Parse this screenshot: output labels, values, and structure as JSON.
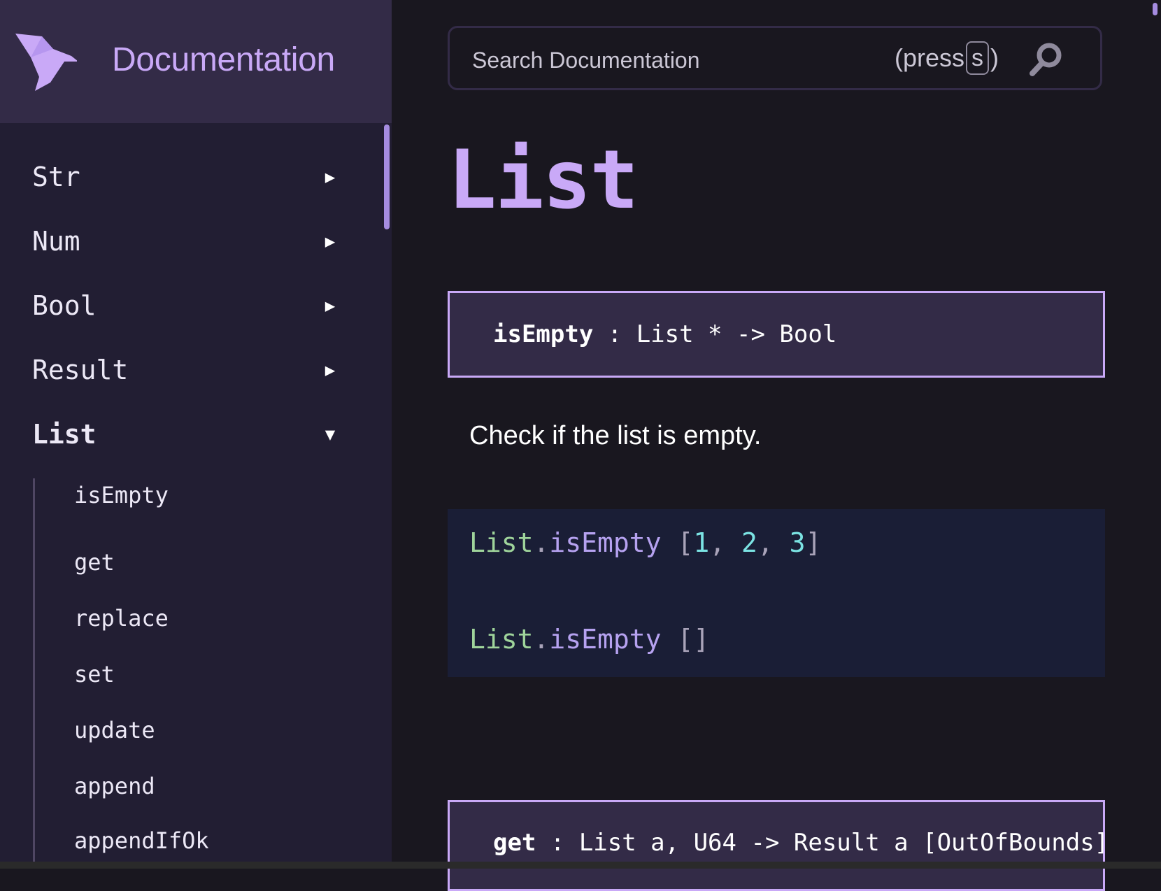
{
  "header": {
    "title": "Documentation"
  },
  "search": {
    "placeholder": "Search Documentation",
    "hint_prefix": "(press ",
    "hint_key": "s",
    "hint_suffix": ")"
  },
  "sidebar": {
    "modules": [
      {
        "label": "Str",
        "arrow": "▶"
      },
      {
        "label": "Num",
        "arrow": "▶"
      },
      {
        "label": "Bool",
        "arrow": "▶"
      },
      {
        "label": "Result",
        "arrow": "▶"
      },
      {
        "label": "List",
        "arrow": "▼",
        "expanded": true
      }
    ],
    "list_entries": [
      "isEmpty",
      "get",
      "replace",
      "set",
      "update",
      "append",
      "appendIfOk"
    ]
  },
  "main": {
    "page_title": "List",
    "entries": [
      {
        "name": "isEmpty",
        "signature": " : List * -> Bool",
        "description": "Check if the list is empty.",
        "examples": [
          {
            "module": "List",
            "dot": ".",
            "fn": "isEmpty",
            "space": " ",
            "open": "[",
            "n1": "1",
            "sep1": ", ",
            "n2": "2",
            "sep2": ", ",
            "n3": "3",
            "close": "]"
          },
          {
            "module": "List",
            "dot": ".",
            "fn": "isEmpty",
            "space": " ",
            "empty": "[]"
          }
        ]
      },
      {
        "name": "get",
        "signature": " : List a, U64 -> Result a [OutOfBounds]"
      }
    ]
  },
  "colors": {
    "accent": "#c9a9f7",
    "sidebar_bg": "#221e33",
    "header_bg": "#332b47",
    "page_bg": "#19171f",
    "code_bg": "#1a1e36"
  },
  "icons": {
    "logo": "roc-bird-logo",
    "search": "search-icon"
  }
}
